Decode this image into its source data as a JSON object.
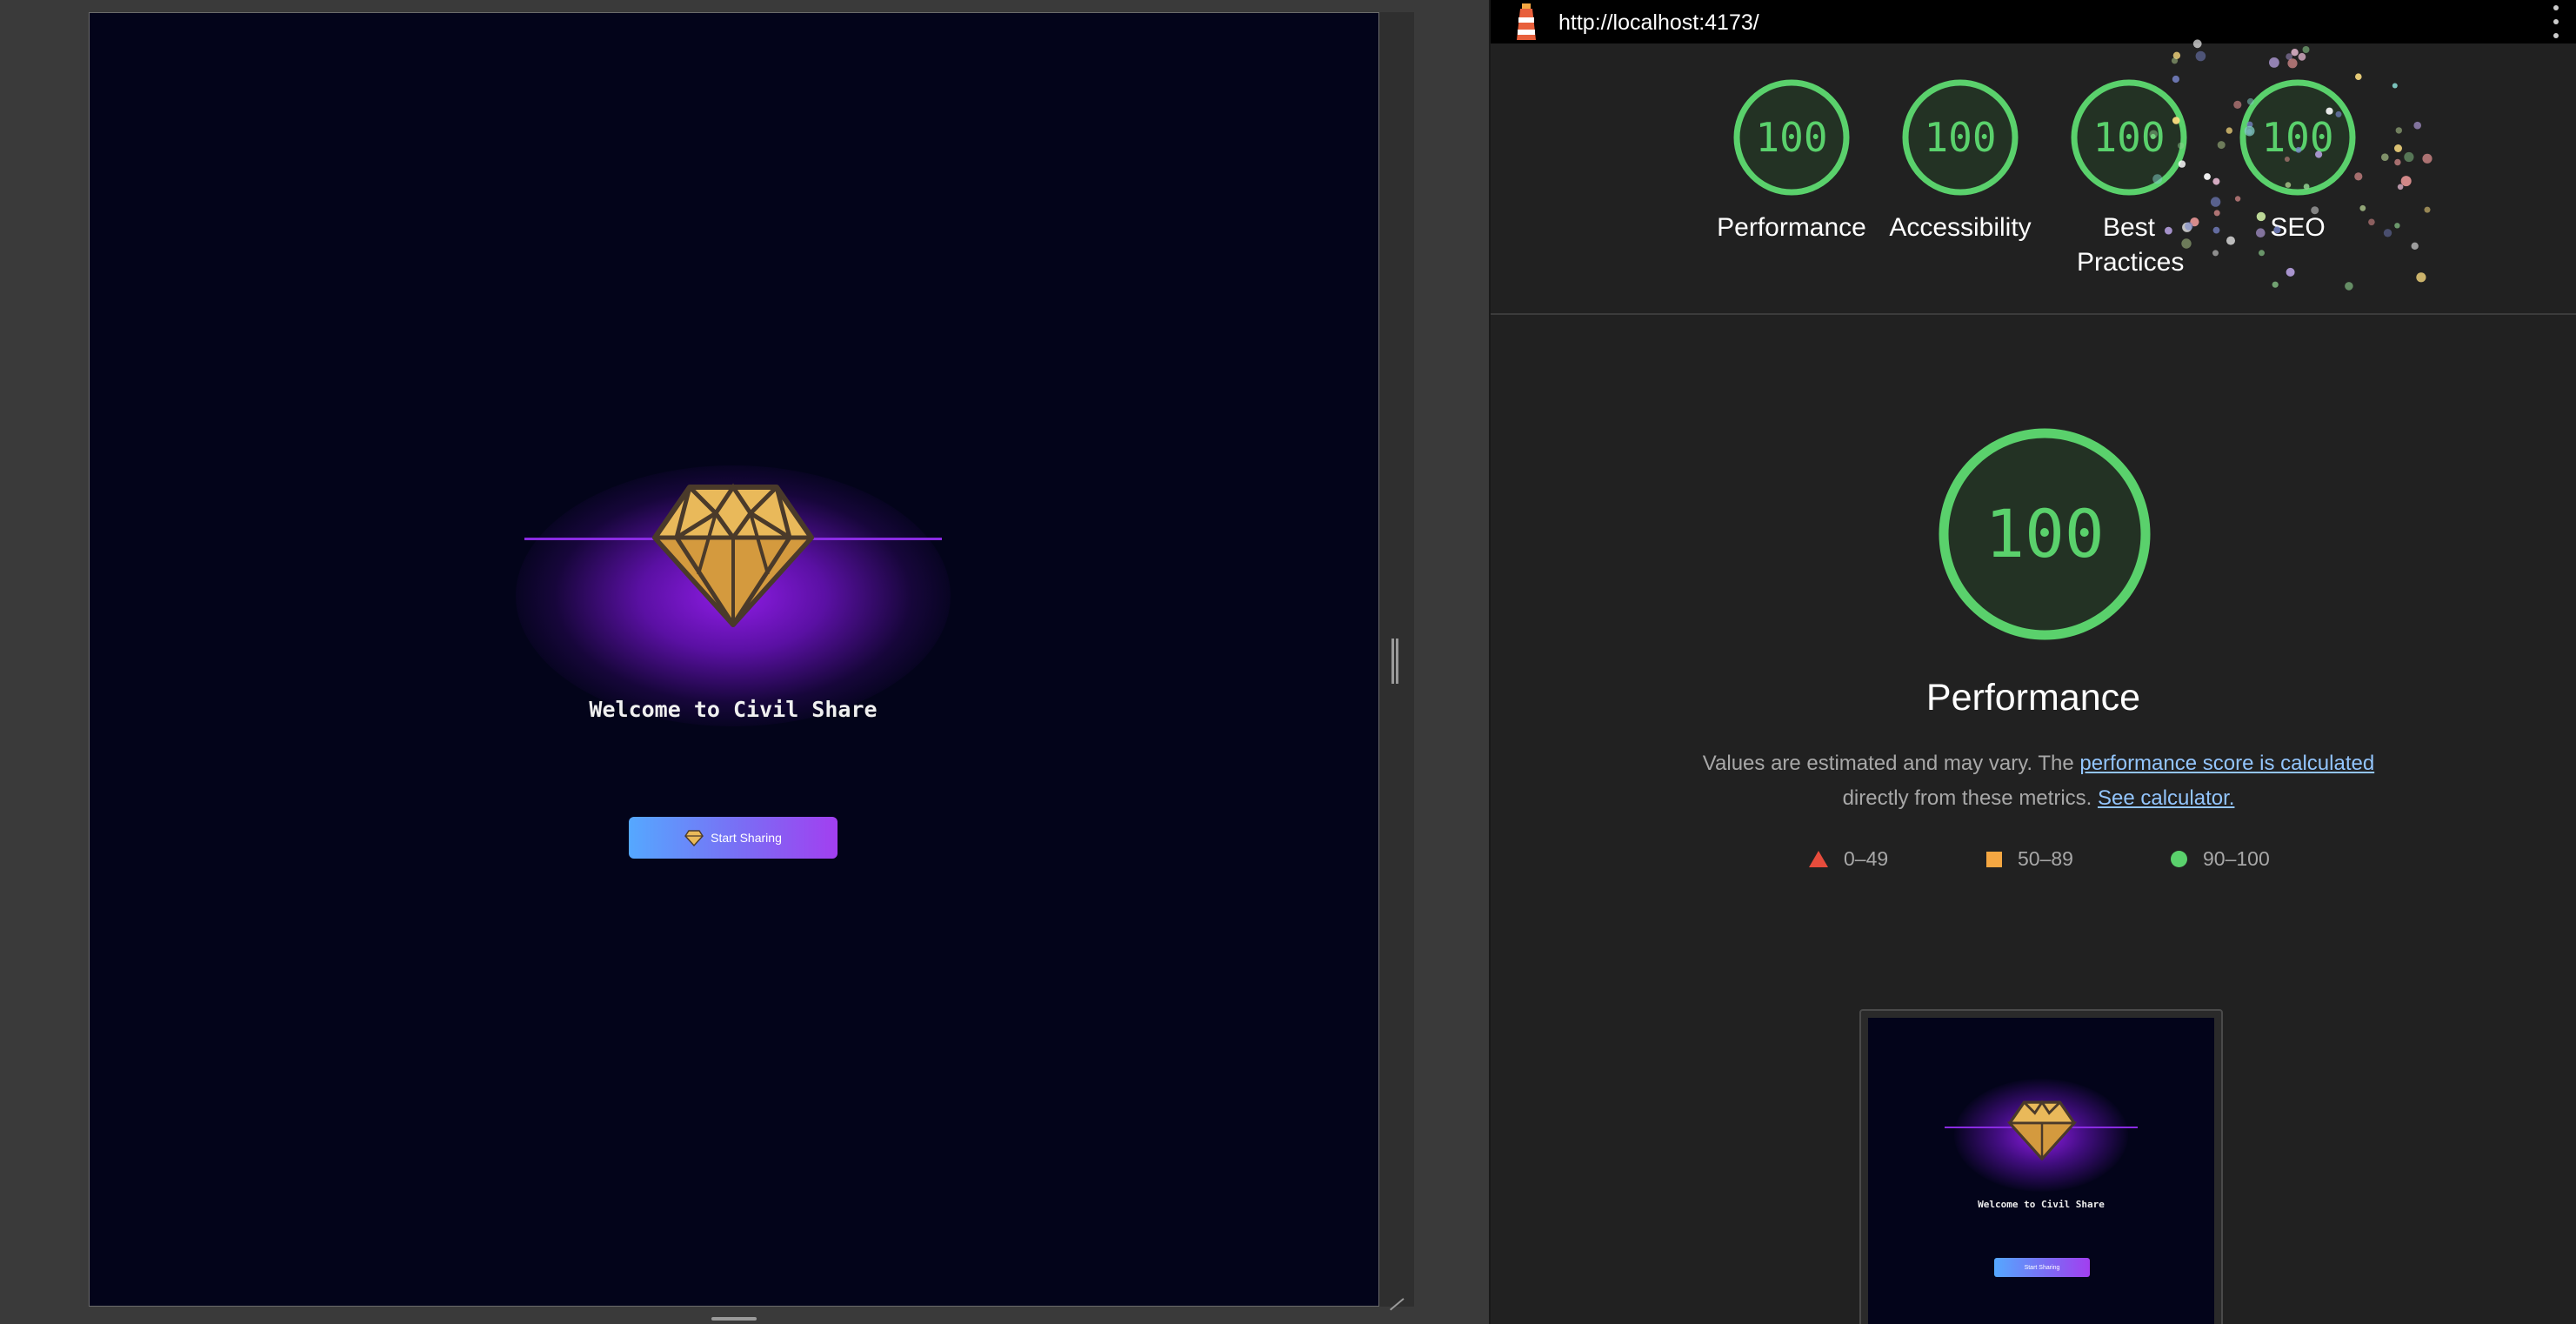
{
  "emulator": {
    "welcome_text": "Welcome to Civil Share",
    "start_button_label": "Start Sharing",
    "accent_color": "#8a2be2",
    "background_color": "#03041a"
  },
  "lighthouse": {
    "url": "http://localhost:4173/",
    "categories": [
      {
        "label": "Performance",
        "score": "100"
      },
      {
        "label": "Accessibility",
        "score": "100"
      },
      {
        "label": "Best Practices",
        "score": "100"
      },
      {
        "label": "SEO",
        "score": "100"
      }
    ],
    "performance": {
      "score": "100",
      "title": "Performance",
      "desc_prefix": "Values are estimated and may vary. The",
      "desc_link1": "performance score is calculated",
      "desc_middle": "directly from these metrics.",
      "desc_link2": "See calculator."
    },
    "legend": [
      {
        "icon": "triangle-icon",
        "range": "0–49",
        "color": "#e74c3c"
      },
      {
        "icon": "square-icon",
        "range": "50–89",
        "color": "#f5a742"
      },
      {
        "icon": "circle-icon",
        "range": "90–100",
        "color": "#5ad16c"
      }
    ],
    "thumbnail": {
      "welcome_text": "Welcome to Civil Share",
      "button_label": "Start Sharing"
    },
    "pass_color": "#5ad16c"
  }
}
